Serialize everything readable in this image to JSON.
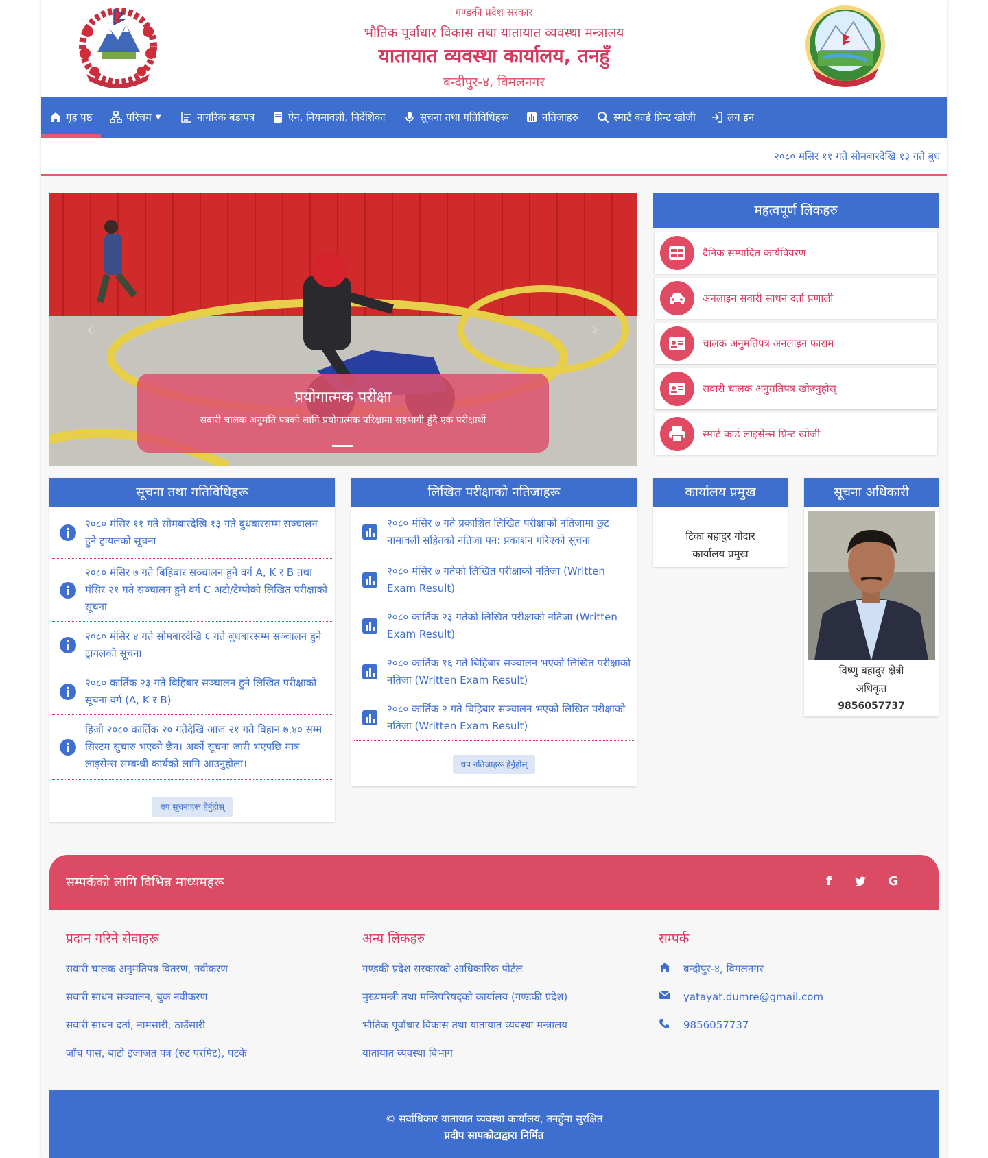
{
  "header": {
    "line1": "गण्डकी प्रदेश सरकार",
    "line2": "भौतिक पूर्वाधार विकास तथा यातायात व्यवस्था मन्त्रालय",
    "line3": "यातायात व्यवस्था कार्यालय, तनहुँ",
    "line4": "बन्दीपुर-४, विमलनगर"
  },
  "nav": {
    "items": [
      {
        "label": "गृह पृष्ठ",
        "icon": "home-icon"
      },
      {
        "label": "परिचय",
        "icon": "sitemap-icon"
      },
      {
        "label": "नागरिक बडापत्र",
        "icon": "list-icon"
      },
      {
        "label": "ऐन, नियमावली, निर्देशिका",
        "icon": "book-icon"
      },
      {
        "label": "सूचना तथा गतिविधिहरू",
        "icon": "microphone-icon"
      },
      {
        "label": "नतिजाहरु",
        "icon": "chart-icon"
      },
      {
        "label": "स्मार्ट कार्ड प्रिन्ट खोजी",
        "icon": "search-icon"
      },
      {
        "label": "लग इन",
        "icon": "login-icon"
      }
    ]
  },
  "ticker": {
    "text": "२०८० मंसिर ११ गते सोमबारदेखि १३ गते बुध"
  },
  "slider": {
    "caption_title": "प्रयोगात्मक परीक्षा",
    "caption_text": "सवारी चालक अनुमति पत्रको लागि प्रयोगात्मक परिक्षामा सहभागी हुँदै एक परीक्षार्थी"
  },
  "important_links": {
    "title": "महत्वपूर्ण लिंकहरु",
    "items": [
      {
        "label": "दैनिक सम्पादित कार्यविवरण",
        "icon": "table-icon"
      },
      {
        "label": "अनलाइन सवारी साधन दर्ता प्रणाली",
        "icon": "car-icon"
      },
      {
        "label": "चालक अनुमतिपत्र अनलाइन फाराम",
        "icon": "id-card-icon"
      },
      {
        "label": "सवारी चालक अनुमतिपत्र खोज्नुहोस्",
        "icon": "id-card-icon"
      },
      {
        "label": "स्मार्ट कार्ड लाइसेन्स प्रिन्ट खोजी",
        "icon": "printer-icon"
      }
    ]
  },
  "notices": {
    "title": "सूचना तथा गतिविधिहरू",
    "items": [
      "२०८० मंसिर ११ गते सोमबारदेखि १३ गते बुधबारसम्म सञ्चालन हुने ट्रायलको सूचना",
      "२०८० मंसिर ७ गते बिहिबार सञ्चालन हुने वर्ग A, K र B तथा मंसिर २१ गते सञ्चालन हुने वर्ग C अटो/टेम्पोको लिखित परीक्षाको सूचना",
      "२०८० मंसिर ४ गते सोमबारदेखि ६ गते बुधबारसम्म सञ्चालन हुने ट्रायलको सूचना",
      "२०८० कार्तिक २३ गते बिहिबार सञ्चालन हुने लिखित परीक्षाको सूचना वर्ग (A, K र B)",
      "हिजो २०८० कार्तिक २० गतेदेखि आज २१ गते बिहान ७.४० सम्म सिस्टम सुचारु भएको छैन। अर्को सूचना जारी भएपछि मात्र लाइसेन्स सम्बन्धी कार्यको लागि आउनुहोला।"
    ],
    "more_label": "थप सूचनाहरू हेर्नुहोस्"
  },
  "results": {
    "title": "लिखित परीक्षाको नतिजाहरू",
    "items": [
      "२०८० मंसिर ७ गते प्रकाशित लिखित परीक्षाको नतिजामा छुट नामावली सहितको नतिजा पन: प्रकाशन गरिएको सूचना",
      "२०८० मंसिर ७ गतेको लिखित परीक्षाको नतिजा (Written Exam Result)",
      "२०८० कार्तिक २३ गतेको लिखित परीक्षाको नतिजा (Written Exam Result)",
      "२०८० कार्तिक १६ गते बिहिबार सञ्चालन भएको लिखित परीक्षाको नतिजा (Written Exam Result)",
      "२०८० कार्तिक २ गते बिहिबार सञ्चालन भएको लिखित परीक्षाको नतिजा (Written Exam Result)"
    ],
    "more_label": "थप नतिजाहरू हेर्नुहोस्"
  },
  "office_chief": {
    "title": "कार्यालय प्रमुख",
    "name": "टिका बहादुर गोदार",
    "role": "कार्यालय प्रमुख"
  },
  "info_officer": {
    "title": "सूचना अधिकारी",
    "name": "विष्णु बहादुर क्षेत्री",
    "role": "अधिकृत",
    "phone": "9856057737"
  },
  "contact_banner": {
    "title": "सम्पर्कको लागि विभिन्न माध्यमहरू",
    "social": [
      {
        "label": "f",
        "icon": "facebook-icon"
      },
      {
        "label": "t",
        "icon": "twitter-icon"
      },
      {
        "label": "G",
        "icon": "google-icon"
      }
    ]
  },
  "footer": {
    "services": {
      "title": "प्रदान गरिने सेवाहरू",
      "items": [
        "सवारी चालक अनुमतिपत्र वितरण, नवीकरण",
        "सवारी साधन सञ्चालन, बुक नवीकरण",
        "सवारी साधन दर्ता, नामसारी, ठाउँसारी",
        "जाँच पास, बाटो इजाजत पत्र (रुट परमिट), पटके"
      ]
    },
    "other_links": {
      "title": "अन्य लिंकहरु",
      "items": [
        "गण्डकी प्रदेश सरकारको आधिकारिक पोर्टल",
        "मुख्यमन्त्री तथा मन्त्रिपरिषद्को कार्यालय (गण्डकी प्रदेश)",
        "भौतिक पूर्वाधार विकास तथा यातायात व्यवस्था मन्त्रालय",
        "यातायात व्यवस्था विभाग"
      ]
    },
    "contact": {
      "title": "सम्पर्क",
      "address": "बन्दीपुर-४, विमलनगर",
      "email": "yatayat.dumre@gmail.com",
      "phone": "9856057737"
    },
    "copyright": "© सर्वाधिकार यातायात व्यवस्था कार्यालय, तनहुँमा सुरक्षित",
    "credit": "प्रदीप सापकोटाद्वारा निर्मित"
  },
  "colors": {
    "primary_blue": "#3e6fcf",
    "accent_red": "#dc4b64",
    "text_red": "#d8375e"
  }
}
